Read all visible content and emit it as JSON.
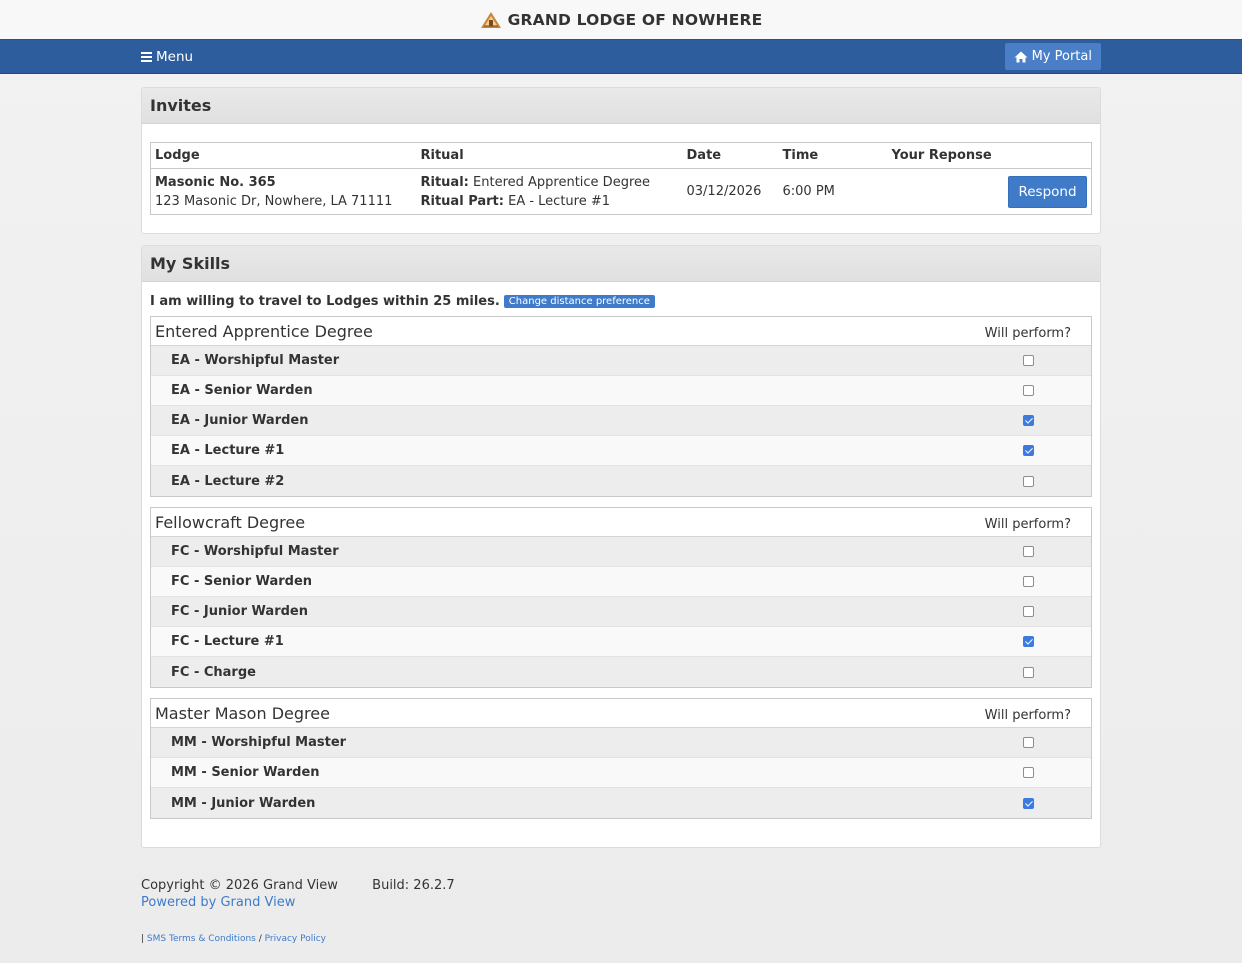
{
  "header": {
    "brand_name": "GRAND LODGE OF NOWHERE"
  },
  "nav": {
    "menu_label": "Menu",
    "portal_label": "My Portal"
  },
  "invites": {
    "title": "Invites",
    "columns": [
      "Lodge",
      "Ritual",
      "Date",
      "Time",
      "Your Reponse"
    ],
    "rows": [
      {
        "lodge_name": "Masonic No. 365",
        "lodge_address": "123 Masonic Dr, Nowhere, LA 71111",
        "ritual_label": "Ritual:",
        "ritual_value": "Entered Apprentice Degree",
        "ritual_part_label": "Ritual Part:",
        "ritual_part_value": "EA - Lecture #1",
        "date": "03/12/2026",
        "time": "6:00 PM",
        "respond_label": "Respond"
      }
    ]
  },
  "skills": {
    "title": "My Skills",
    "travel_text": "I am willing to travel to Lodges within 25 miles.",
    "distance_button": "Change distance preference",
    "will_perform_label": "Will perform?",
    "degrees": [
      {
        "name": "Entered Apprentice Degree",
        "items": [
          {
            "label": "EA - Worshipful Master",
            "checked": false
          },
          {
            "label": "EA - Senior Warden",
            "checked": false
          },
          {
            "label": "EA - Junior Warden",
            "checked": true
          },
          {
            "label": "EA - Lecture #1",
            "checked": true
          },
          {
            "label": "EA - Lecture #2",
            "checked": false
          }
        ]
      },
      {
        "name": "Fellowcraft Degree",
        "items": [
          {
            "label": "FC - Worshipful Master",
            "checked": false
          },
          {
            "label": "FC - Senior Warden",
            "checked": false
          },
          {
            "label": "FC - Junior Warden",
            "checked": false
          },
          {
            "label": "FC - Lecture #1",
            "checked": true
          },
          {
            "label": "FC - Charge",
            "checked": false
          }
        ]
      },
      {
        "name": "Master Mason Degree",
        "items": [
          {
            "label": "MM - Worshipful Master",
            "checked": false
          },
          {
            "label": "MM - Senior Warden",
            "checked": false
          },
          {
            "label": "MM - Junior Warden",
            "checked": true
          }
        ]
      }
    ]
  },
  "footer": {
    "copyright": "Copyright © 2026 Grand View",
    "build": "Build: 26.2.7",
    "powered_by": "Powered by Grand View",
    "separator": "|",
    "sms_terms": "SMS Terms & Conditions",
    "slash": "/",
    "privacy": "Privacy Policy"
  },
  "colors": {
    "navbar": "#2e5d9e",
    "accent": "#3f7bc9",
    "checkbox_checked": "#3c7ae0"
  }
}
